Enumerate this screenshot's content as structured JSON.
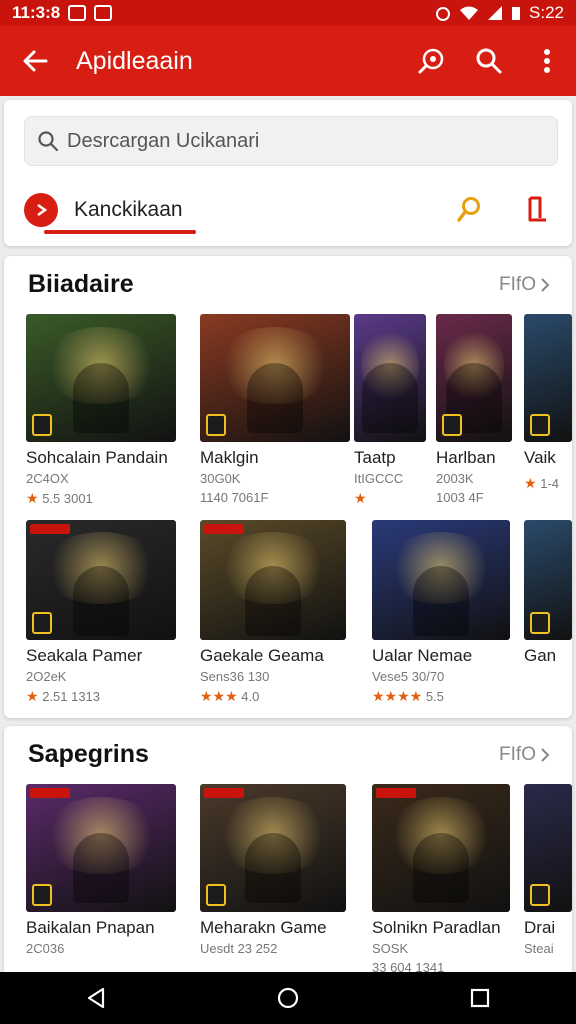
{
  "status_bar": {
    "time_left": "11:3:8",
    "time_right": "S:22"
  },
  "app_bar": {
    "title": "Apidleaain"
  },
  "search": {
    "placeholder": "Desrcargan Ucikanari"
  },
  "category": {
    "label": "Kanckikaan"
  },
  "sections": [
    {
      "title": "Biiadaire",
      "more": "FIfO",
      "tiles": [
        {
          "name": "Sohcalain Pandain",
          "sub": "2C4OX",
          "rating": "5.5 3001",
          "color": "#3a5a28"
        },
        {
          "name": "Maklgin",
          "sub": "30G0K",
          "rating": "1140 7061F",
          "color": "#8a3a22"
        },
        {
          "name": "Taatp",
          "sub": "ItIGCCC",
          "rating": "",
          "color": "#5a3a8a"
        },
        {
          "name": "Harlban",
          "sub": "2003K",
          "rating": "1003 4F",
          "color": "#6a2a4a"
        },
        {
          "name": "Vaik",
          "sub": "",
          "rating": "1-4",
          "color": "#2a4a6a"
        },
        {
          "name": "Seakala Pamer",
          "sub": "2O2eK",
          "rating": "2.51 1313",
          "color": "#2a2a2a"
        },
        {
          "name": "Gaekale Geama",
          "sub": "Sens36 130",
          "rating": "4.0",
          "color": "#5a4a28"
        },
        {
          "name": "Ualar Nemae",
          "sub": "Vese5 30/70",
          "rating": "5.5",
          "color": "#2a3a7a"
        },
        {
          "name": "Gan",
          "sub": "",
          "rating": "",
          "color": "#2a4a6a"
        }
      ]
    },
    {
      "title": "Sapegrins",
      "more": "FIfO",
      "tiles": [
        {
          "name": "Baikalan Pnapan",
          "sub": "2C036",
          "rating": "",
          "color": "#5a2a6a"
        },
        {
          "name": "Meharakn Game",
          "sub": "Uesdt 23 252",
          "rating": "",
          "color": "#4a3a2a"
        },
        {
          "name": "Solnikn Paradlan",
          "sub": "SOSK",
          "rating": "33 604 1341",
          "color": "#3a2a1a"
        },
        {
          "name": "Drai",
          "sub": "Steai",
          "rating": "",
          "color": "#2a2a4a"
        }
      ]
    }
  ]
}
